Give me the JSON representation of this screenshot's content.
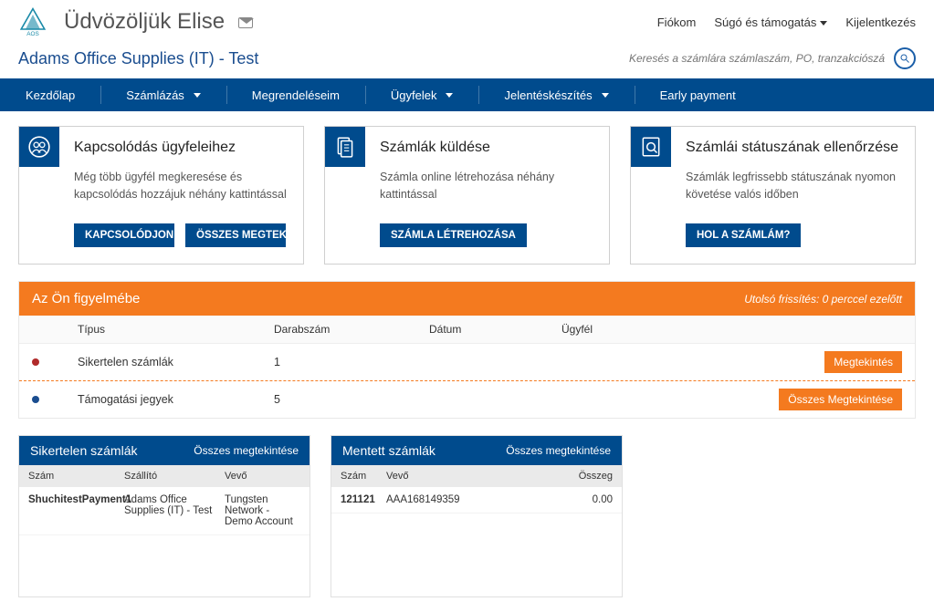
{
  "header": {
    "welcome": "Üdvözöljük Elise",
    "links": {
      "account": "Fiókom",
      "help": "Súgó és támogatás",
      "logout": "Kijelentkezés"
    }
  },
  "subheader": {
    "company": "Adams Office Supplies (IT) - Test",
    "search_placeholder": "Keresés a számlára számlaszám, PO, tranzakciószám alapján"
  },
  "nav": {
    "home": "Kezdőlap",
    "invoicing": "Számlázás",
    "orders": "Megrendeléseim",
    "customers": "Ügyfelek",
    "reporting": "Jelentéskészítés",
    "early": "Early payment"
  },
  "cards": {
    "connect": {
      "title": "Kapcsolódás ügyfeleihez",
      "desc": "Még több ügyfél megkeresése és kapcsolódás hozzájuk néhány kattintással",
      "btn1": "KAPCSOLÓDJON MOST",
      "btn2": "ÖSSZES MEGTEKINTÉSE"
    },
    "send": {
      "title": "Számlák küldése",
      "desc": "Számla online létrehozása néhány kattintással",
      "btn1": "SZÁMLA LÉTREHOZÁSA"
    },
    "status": {
      "title": "Számlái státuszának ellenőrzése",
      "desc": "Számlák legfrissebb státuszának nyomon követése valós időben",
      "btn1": "HOL A SZÁMLÁM?"
    }
  },
  "attention": {
    "title": "Az Ön figyelmébe",
    "updated": "Utolsó frissítés: 0 perccel ezelőtt",
    "headers": {
      "type": "Típus",
      "count": "Darabszám",
      "date": "Dátum",
      "client": "Ügyfél"
    },
    "rows": [
      {
        "dot": "#b02a2a",
        "type": "Sikertelen számlák",
        "count": "1",
        "date": "",
        "client": "",
        "action": "Megtekintés"
      },
      {
        "dot": "#1a4d8f",
        "type": "Támogatási jegyek",
        "count": "5",
        "date": "",
        "client": "",
        "action": "Összes Megtekintése"
      }
    ]
  },
  "widget_failed": {
    "title": "Sikertelen számlák",
    "all": "Összes megtekintése",
    "cols": {
      "num": "Szám",
      "supplier": "Szállító",
      "buyer": "Vevő"
    },
    "row": {
      "num": "ShuchitestPayment1",
      "supplier": "Adams Office Supplies (IT) - Test",
      "buyer": "Tungsten Network - Demo Account"
    }
  },
  "widget_saved": {
    "title": "Mentett számlák",
    "all": "Összes megtekintése",
    "cols": {
      "num": "Szám",
      "buyer": "Vevő",
      "amount": "Összeg"
    },
    "row": {
      "num": "121121",
      "buyer": "AAA168149359",
      "amount": "0.00"
    }
  }
}
